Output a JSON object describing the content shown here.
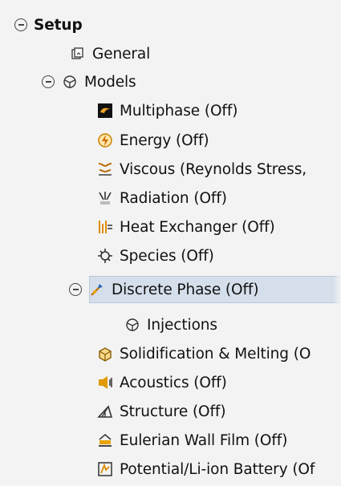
{
  "tree": {
    "root": {
      "label": "Setup"
    },
    "general": {
      "label": "General",
      "icon": "general-icon"
    },
    "models": {
      "label": "Models",
      "icon": "models-icon",
      "items": [
        {
          "label": "Multiphase (Off)",
          "icon": "multiphase-icon"
        },
        {
          "label": "Energy (Off)",
          "icon": "energy-icon"
        },
        {
          "label": "Viscous (Reynolds Stress,",
          "icon": "viscous-icon"
        },
        {
          "label": "Radiation (Off)",
          "icon": "radiation-icon"
        },
        {
          "label": "Heat Exchanger (Off)",
          "icon": "heat-exchanger-icon"
        },
        {
          "label": "Species (Off)",
          "icon": "species-icon"
        },
        {
          "label": "Discrete Phase (Off)",
          "icon": "discrete-phase-icon",
          "selected": true
        },
        {
          "label": "Injections",
          "icon": "injections-icon"
        },
        {
          "label": "Solidification & Melting (O",
          "icon": "solidification-icon"
        },
        {
          "label": "Acoustics (Off)",
          "icon": "acoustics-icon"
        },
        {
          "label": "Structure (Off)",
          "icon": "structure-icon"
        },
        {
          "label": "Eulerian Wall Film (Off)",
          "icon": "eulerian-wall-film-icon"
        },
        {
          "label": "Potential/Li-ion Battery (Of",
          "icon": "battery-icon"
        }
      ]
    }
  }
}
